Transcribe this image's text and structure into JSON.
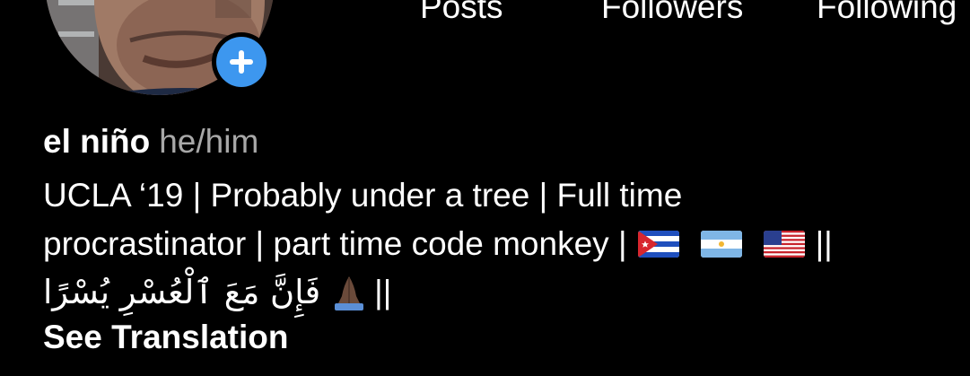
{
  "stats": {
    "posts_label": "Posts",
    "followers_label": "Followers",
    "following_label": "Following"
  },
  "profile": {
    "name": "el niño",
    "pronouns": "he/him"
  },
  "bio": {
    "line1": "UCLA ‘19 | Probably under a tree | Full time",
    "line2": "procrastinator | part time code monkey |",
    "line2_end": "||",
    "line3_start": "||",
    "line3_arabic": "فَإِنَّ مَعَ ٱلْعُسْرِ يُسْرًا",
    "flags": [
      "cuba-flag-icon",
      "argentina-flag-icon",
      "usa-flag-icon"
    ]
  },
  "actions": {
    "see_translation": "See Translation"
  },
  "colors": {
    "background": "#000000",
    "text": "#ffffff",
    "secondary_text": "#a8a8a8",
    "add_button": "#3d97ef"
  }
}
